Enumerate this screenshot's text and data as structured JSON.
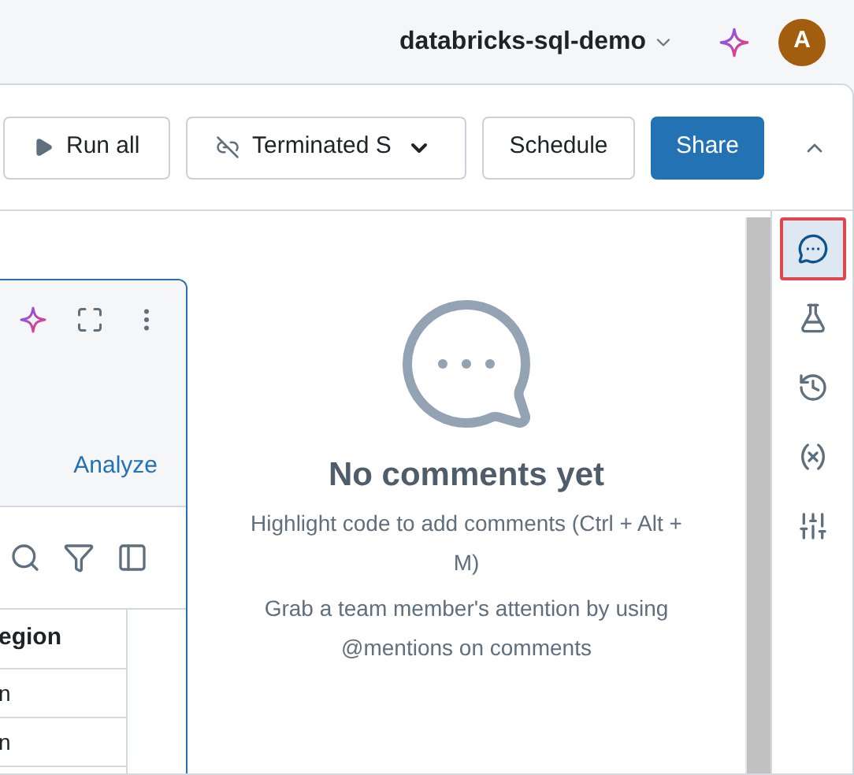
{
  "header": {
    "workspace": "databricks-sql-demo",
    "avatar": "A"
  },
  "toolbar": {
    "run_all": "Run all",
    "compute": "Terminated S",
    "schedule": "Schedule",
    "share": "Share"
  },
  "cell": {
    "analyze": "Analyze",
    "table": {
      "column_1": "egion",
      "rows": [
        "n",
        "n"
      ]
    }
  },
  "comments": {
    "title": "No comments yet",
    "hint": "Highlight code to add comments (Ctrl + Alt + M)",
    "tip": "Grab a team member's attention by using @mentions on comments"
  },
  "rail": [
    {
      "kind": "comments",
      "selected": true
    },
    {
      "kind": "experiments",
      "selected": false
    },
    {
      "kind": "history",
      "selected": false
    },
    {
      "kind": "variables",
      "selected": false
    },
    {
      "kind": "environment",
      "selected": false
    }
  ]
}
